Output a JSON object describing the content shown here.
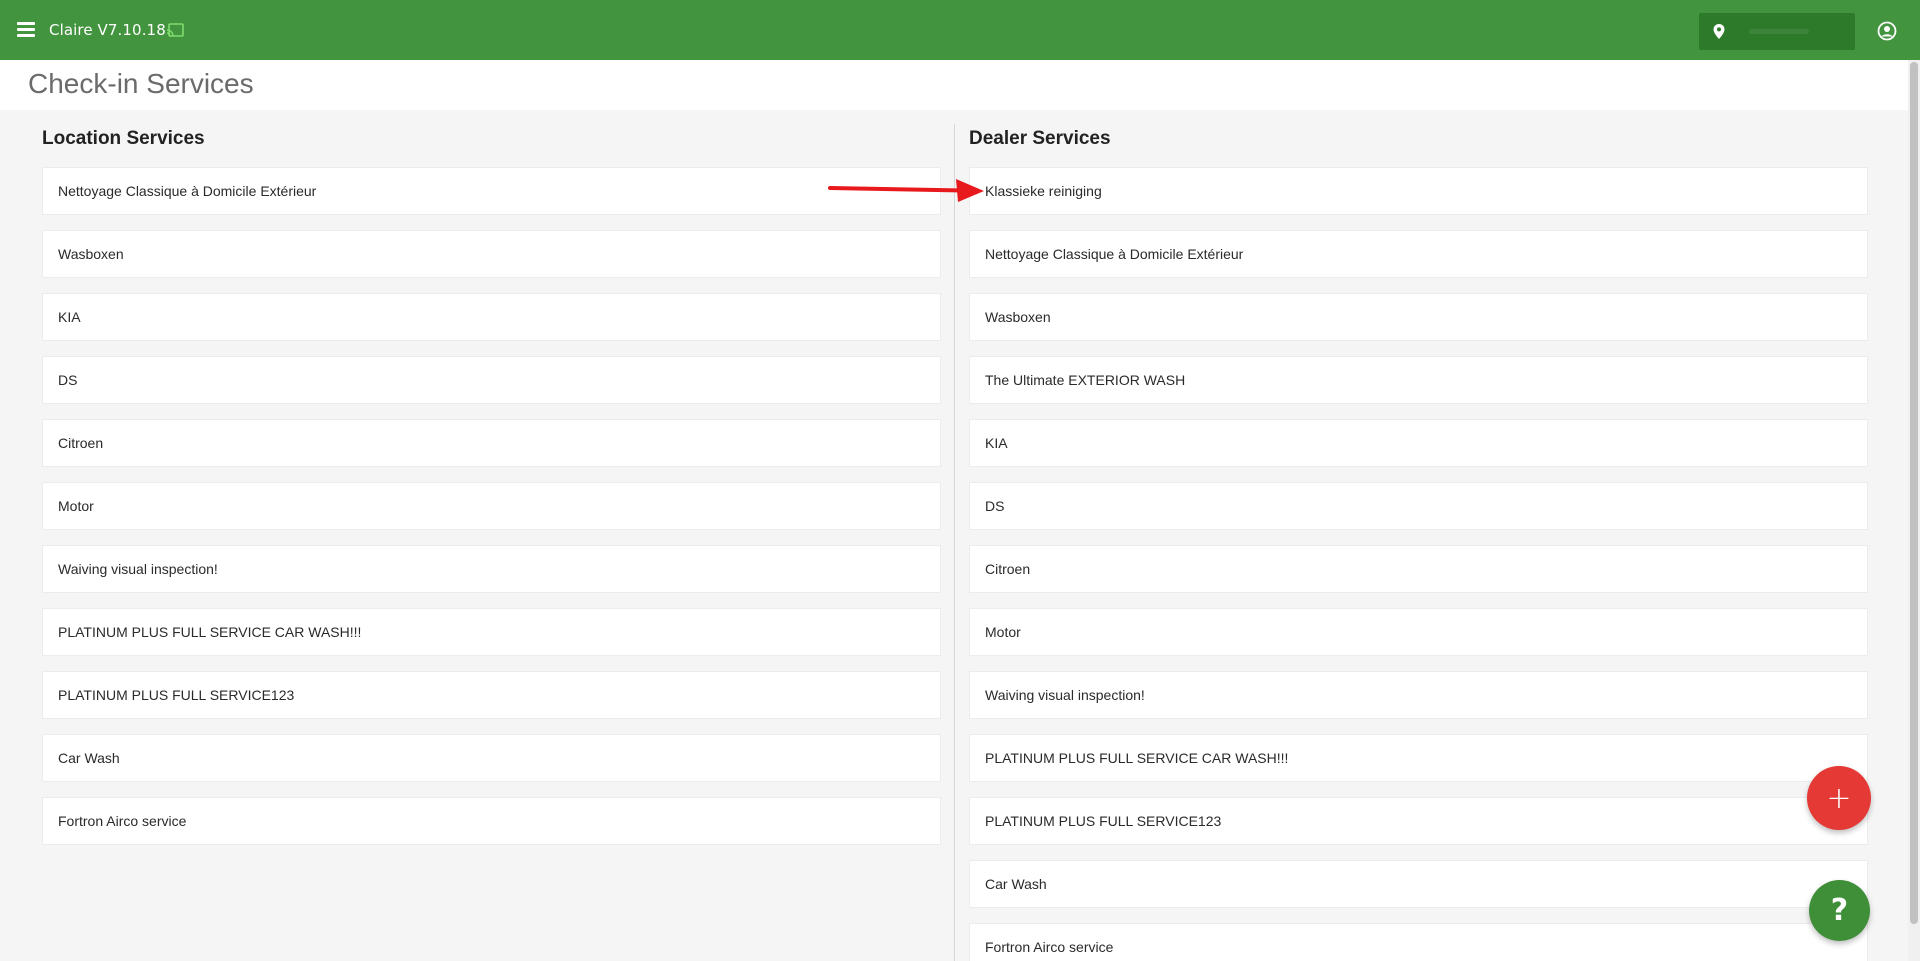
{
  "topbar": {
    "app_title": "Claire V7.10.18",
    "menu_icon": "hamburger-menu-icon",
    "cast_icon": "cast-icon",
    "location_icon": "location-pin-icon",
    "account_icon": "account-circle-icon",
    "bg_color": "#43943f"
  },
  "page": {
    "title": "Check-in Services"
  },
  "location_services": {
    "title": "Location Services",
    "items": [
      "Nettoyage Classique à Domicile Extérieur",
      "Wasboxen",
      "KIA",
      "DS",
      "Citroen",
      "Motor",
      "Waiving visual inspection!",
      "PLATINUM PLUS FULL SERVICE CAR WASH!!!",
      "PLATINUM PLUS FULL SERVICE123",
      "Car Wash",
      "Fortron Airco service"
    ]
  },
  "dealer_services": {
    "title": "Dealer Services",
    "items": [
      "Klassieke reiniging",
      "Nettoyage Classique à Domicile Extérieur",
      "Wasboxen",
      "The Ultimate EXTERIOR WASH",
      "KIA",
      "DS",
      "Citroen",
      "Motor",
      "Waiving visual inspection!",
      "PLATINUM PLUS FULL SERVICE CAR WASH!!!",
      "PLATINUM PLUS FULL SERVICE123",
      "Car Wash",
      "Fortron Airco service"
    ]
  },
  "fab": {
    "add_label": "+",
    "help_label": "?",
    "add_color": "#e53935",
    "help_color": "#3f8f39"
  },
  "annotation": {
    "arrow_color": "#e8191c"
  }
}
